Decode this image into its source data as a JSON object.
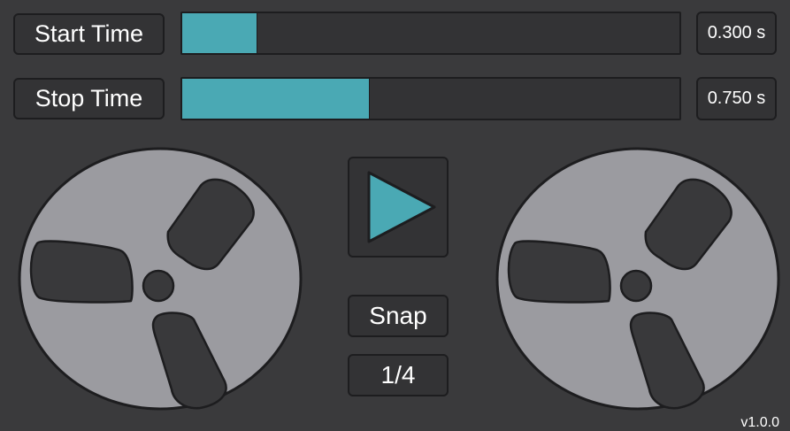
{
  "start_time": {
    "label": "Start Time",
    "value": "0.300 s",
    "fraction": 0.15
  },
  "stop_time": {
    "label": "Stop Time",
    "value": "0.750 s",
    "fraction": 0.375
  },
  "play": {
    "icon": "play-icon"
  },
  "snap": {
    "label": "Snap",
    "value": "1/4"
  },
  "reels": {
    "left_icon": "tape-reel-icon",
    "right_icon": "tape-reel-icon"
  },
  "version": "v1.0.0",
  "colors": {
    "background": "#3a3a3c",
    "panel": "#333335",
    "accent": "#4aa9b4",
    "reel": "#9b9ba0"
  }
}
